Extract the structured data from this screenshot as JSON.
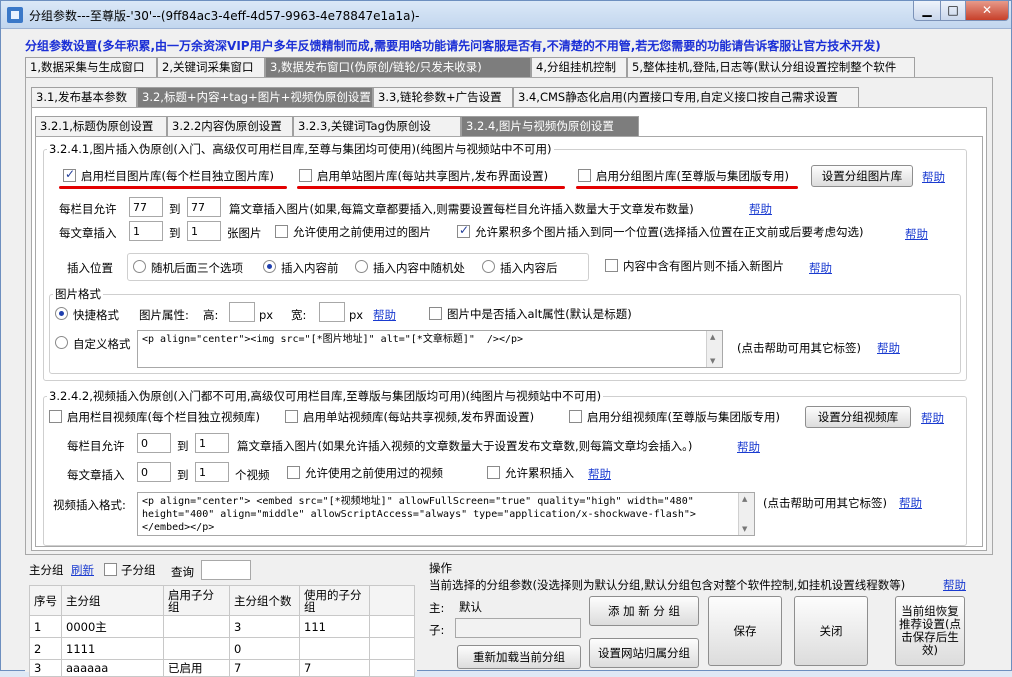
{
  "window": {
    "title": "分组参数---至尊版-'30'--(9ff84ac3-4eff-4d57-9963-4e78847e1a1a)-",
    "min_label": "▁",
    "max_label": "□",
    "close_label": "✕"
  },
  "banner": "分组参数设置(多年积累,由一万余资深VIP用户多年反馈精制而成,需要用啥功能请先问客服是否有,不清楚的不用管,若无您需要的功能请告诉客服让官方技术开发)",
  "main_tabs": [
    {
      "label": "1,数据采集与生成窗口"
    },
    {
      "label": "2,关键词采集窗口"
    },
    {
      "label": "3,数据发布窗口(伪原创/链轮/只发未收录)"
    },
    {
      "label": "4,分组挂机控制"
    },
    {
      "label": "5,整体挂机,登陆,日志等(默认分组设置控制整个软件"
    }
  ],
  "sub_tabs": [
    {
      "label": "3.1,发布基本参数"
    },
    {
      "label": "3.2,标题+内容+tag+图片+视频伪原创设置"
    },
    {
      "label": "3.3,链轮参数+广告设置"
    },
    {
      "label": "3.4,CMS静态化启用(内置接口专用,自定义接口按自己需求设置"
    }
  ],
  "sub_sub_tabs": [
    {
      "label": "3.2.1,标题伪原创设置"
    },
    {
      "label": "3.2.2内容伪原创设置"
    },
    {
      "label": "3.2.3,关键词Tag伪原创设"
    },
    {
      "label": "3.2.4,图片与视频伪原创设置"
    }
  ],
  "image_section": {
    "title": "3.2.4.1,图片插入伪原创(入门、高级仅可用栏目库,至尊与集团均可使用)(纯图片与视频站中不可用)",
    "enable_column_lib": "启用栏目图片库(每个栏目独立图片库)",
    "enable_site_lib": "启用单站图片库(每站共享图片,发布界面设置)",
    "enable_group_lib": "启用分组图片库(至尊版与集团版专用)",
    "set_group_lib_button": "设置分组图片库",
    "help": "帮助",
    "per_column_allow": "每栏目允许",
    "per_column_from": "77",
    "to": "到",
    "per_column_to": "77",
    "per_column_desc": "篇文章插入图片(如果,每篇文章都要插入,则需要设置每栏目允许插入数量大于文章发布数量)",
    "per_article_insert": "每文章插入",
    "per_article_from": "1",
    "per_article_to": "1",
    "per_article_unit": "张图片",
    "allow_reuse": "允许使用之前使用过的图片",
    "allow_stack": "允许累积多个图片插入到同一个位置(选择插入位置在正文前或后要考虑勾选)",
    "insert_position": "插入位置",
    "pos_options": [
      "随机后面三个选项",
      "插入内容前",
      "插入内容中随机处",
      "插入内容后"
    ],
    "skip_if_has_image": "内容中含有图片则不插入新图片",
    "format_group_title": "图片格式",
    "quick_format": "快捷格式",
    "image_attr": "图片属性:",
    "height_label": "高:",
    "width_label": "宽:",
    "px": "px",
    "alt_attr": "图片中是否插入alt属性(默认是标题)",
    "custom_format": "自定义格式",
    "custom_format_value": "<p align=\"center\"><img src=\"[*图片地址]\" alt=\"[*文章标题]\"  /></p>",
    "custom_hint": "(点击帮助可用其它标签)"
  },
  "video_section": {
    "title": "3.2.4.2,视频插入伪原创(入门都不可用,高级仅可用栏目库,至尊版与集团版均可用)(纯图片与视频站中不可用)",
    "enable_column_lib": "启用栏目视频库(每个栏目独立视频库)",
    "enable_site_lib": "启用单站视频库(每站共享视频,发布界面设置)",
    "enable_group_lib": "启用分组视频库(至尊版与集团版专用)",
    "set_group_lib_button": "设置分组视频库",
    "help": "帮助",
    "per_column_allow": "每栏目允许",
    "per_column_from": "0",
    "to": "到",
    "per_column_to": "1",
    "per_column_desc": "篇文章插入图片(如果允许插入视频的文章数量大于设置发布文章数,则每篇文章均会插入。)",
    "per_article_insert": "每文章插入",
    "per_article_from": "0",
    "per_article_to": "1",
    "per_article_unit": "个视频",
    "allow_reuse": "允许使用之前使用过的视频",
    "allow_stack": "允许累积插入",
    "format_label": "视频插入格式:",
    "format_value": "<p align=\"center\"> <embed src=\"[*视频地址]\" allowFullScreen=\"true\" quality=\"high\" width=\"480\" height=\"400\" align=\"middle\" allowScriptAccess=\"always\" type=\"application/x-shockwave-flash\"></embed></p>",
    "custom_hint": "(点击帮助可用其它标签)"
  },
  "group_panel": {
    "title": "主分组",
    "refresh": "刷新",
    "subgroup": "子分组",
    "query": "查询",
    "columns": [
      "序号",
      "主分组",
      "启用子分组",
      "主分组个数",
      "使用的子分组"
    ],
    "rows": [
      [
        "1",
        "0000主",
        "",
        "3",
        "111"
      ],
      [
        "2",
        "1111",
        "",
        "0",
        ""
      ],
      [
        "3",
        "aaaaaa",
        "已启用",
        "7",
        "7"
      ]
    ]
  },
  "ops_panel": {
    "title": "操作",
    "desc": "当前选择的分组参数(没选择则为默认分组,默认分组包含对整个软件控制,如挂机设置线程数等)",
    "help": "帮助",
    "main_label": "主:",
    "main_value": "默认",
    "sub_label": "子:",
    "add_group": "添 加 新 分 组",
    "reload_group": "重新加载当前分组",
    "set_site_group": "设置网站归属分组",
    "save": "保存",
    "close": "关闭",
    "restore": "当前组恢复推荐设置(点击保存后生效)"
  }
}
